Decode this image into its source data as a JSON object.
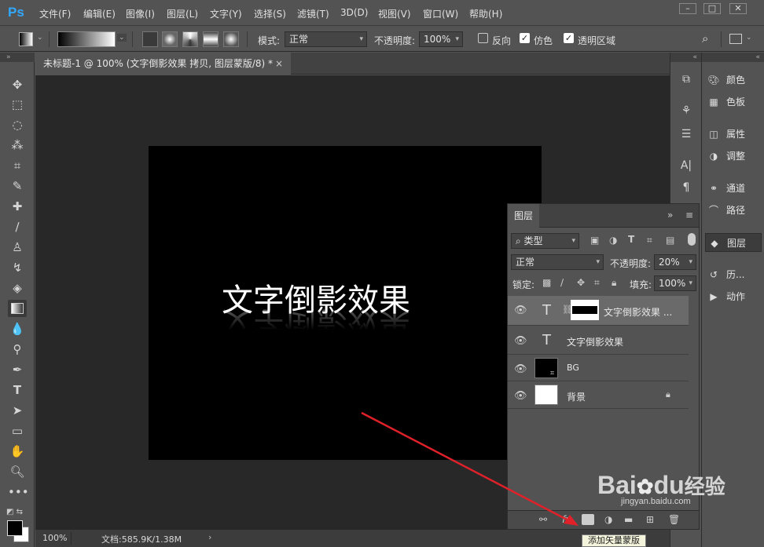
{
  "app": {
    "logo": "Ps"
  },
  "menu": [
    "文件(F)",
    "编辑(E)",
    "图像(I)",
    "图层(L)",
    "文字(Y)",
    "选择(S)",
    "滤镜(T)",
    "3D(D)",
    "视图(V)",
    "窗口(W)",
    "帮助(H)"
  ],
  "options": {
    "mode_label": "模式:",
    "mode_value": "正常",
    "opacity_label": "不透明度:",
    "opacity_value": "100%",
    "reverse_label": "反向",
    "reverse_checked": false,
    "dither_label": "仿色",
    "dither_checked": true,
    "transparency_label": "透明区域",
    "transparency_checked": true
  },
  "document": {
    "tab_title": "未标题-1 @ 100% (文字倒影效果 拷贝, 图层蒙版/8) *",
    "close": "×",
    "canvas_text": "文字倒影效果"
  },
  "status": {
    "zoom": "100%",
    "doc_info": "文档:585.9K/1.38M",
    "arrow": "›"
  },
  "right_panel": [
    {
      "icon": "color-icon",
      "label": "颜色"
    },
    {
      "icon": "swatches-icon",
      "label": "色板"
    },
    {
      "icon": "properties-icon",
      "label": "属性"
    },
    {
      "icon": "adjustments-icon",
      "label": "调整"
    },
    {
      "icon": "channels-icon",
      "label": "通道"
    },
    {
      "icon": "paths-icon",
      "label": "路径"
    },
    {
      "icon": "layers-icon",
      "label": "图层"
    },
    {
      "icon": "history-icon",
      "label": "历..."
    },
    {
      "icon": "actions-icon",
      "label": "动作"
    }
  ],
  "layers_panel": {
    "tab": "图层",
    "filter_type": "类型",
    "blend_mode": "正常",
    "opacity_label": "不透明度:",
    "opacity_value": "20%",
    "lock_label": "锁定:",
    "fill_label": "填充:",
    "fill_value": "100%",
    "layers": [
      {
        "name": "文字倒影效果 ...",
        "kind": "text-with-mask",
        "selected": true
      },
      {
        "name": "文字倒影效果",
        "kind": "text",
        "selected": false
      },
      {
        "name": "BG",
        "kind": "smart",
        "selected": false
      },
      {
        "name": "背景",
        "kind": "background",
        "selected": false
      }
    ]
  },
  "tooltip": "添加矢量蒙版",
  "watermark": {
    "brand": "Bai",
    "paw": "du",
    "suffix": "经验",
    "url": "jingyan.baidu.com"
  },
  "colors": {
    "accent": "#31a8ff",
    "arrow": "#e0212a"
  }
}
